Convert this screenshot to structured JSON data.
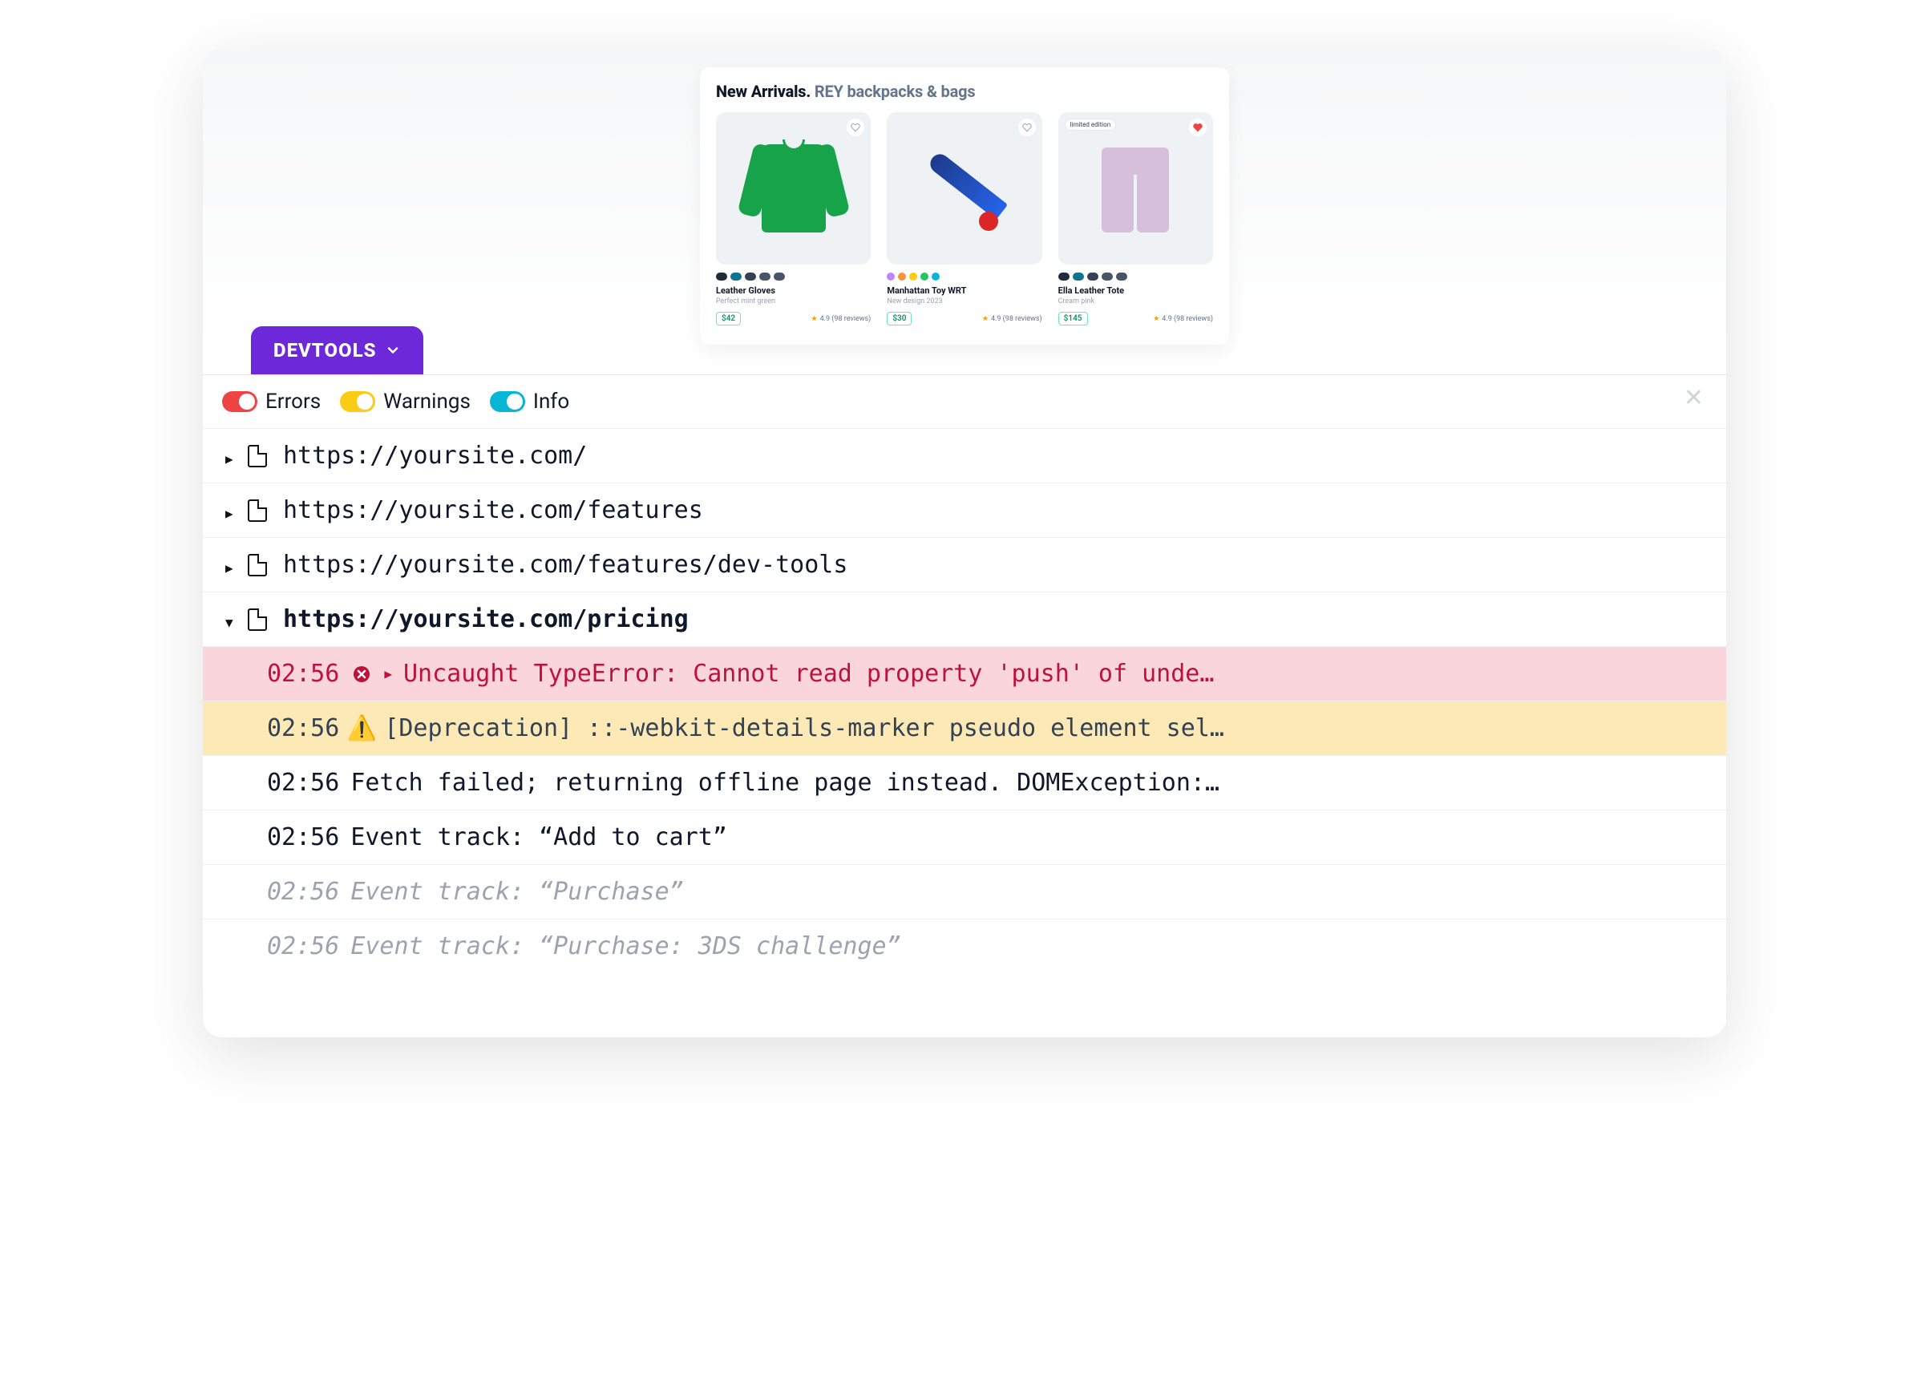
{
  "preview": {
    "title_bold": "New Arrivals.",
    "title_sub": "REY backpacks & bags",
    "products": [
      {
        "name": "Leather Gloves",
        "desc": "Perfect mint green",
        "price": "$42",
        "rating": "4.9 (98 reviews)",
        "badge": null,
        "favorite": false,
        "swatches": [
          "#1f2d3a",
          "#0e7490",
          "#334155",
          "#475569",
          "#475569"
        ],
        "swatch_style": "pill"
      },
      {
        "name": "Manhattan Toy WRT",
        "desc": "New design 2023",
        "price": "$30",
        "rating": "4.9 (98 reviews)",
        "badge": null,
        "favorite": false,
        "swatches": [
          "#c084fc",
          "#fb923c",
          "#facc15",
          "#22c55e",
          "#06b6d4"
        ],
        "swatch_style": "dot"
      },
      {
        "name": "Ella Leather Tote",
        "desc": "Cream pink",
        "price": "$145",
        "rating": "4.9 (98 reviews)",
        "badge": "limited edition",
        "favorite": true,
        "swatches": [
          "#1f2d3a",
          "#0e7490",
          "#334155",
          "#475569",
          "#475569"
        ],
        "swatch_style": "pill"
      }
    ]
  },
  "devtools_label": "DEVTOOLS",
  "filters": {
    "errors": "Errors",
    "warnings": "Warnings",
    "info": "Info"
  },
  "close_symbol": "✕",
  "pages": [
    {
      "url": "https://yoursite.com/",
      "open": false
    },
    {
      "url": "https://yoursite.com/features",
      "open": false
    },
    {
      "url": "https://yoursite.com/features/dev-tools",
      "open": false
    },
    {
      "url": "https://yoursite.com/pricing",
      "open": true
    }
  ],
  "logs": [
    {
      "ts": "02:56",
      "level": "err",
      "expandable": true,
      "msg": "Uncaught TypeError: Cannot read property 'push' of unde…"
    },
    {
      "ts": "02:56",
      "level": "warn",
      "expandable": false,
      "msg": "[Deprecation] ::-webkit-details-marker pseudo element sel…"
    },
    {
      "ts": "02:56",
      "level": "info",
      "expandable": false,
      "msg": "Fetch failed; returning offline page instead. DOMException:…"
    },
    {
      "ts": "02:56",
      "level": "info",
      "expandable": false,
      "msg": "Event track: “Add to cart”"
    },
    {
      "ts": "02:56",
      "level": "faded",
      "expandable": false,
      "msg": "Event track: “Purchase”"
    },
    {
      "ts": "02:56",
      "level": "faded",
      "expandable": false,
      "msg": "Event track: “Purchase: 3DS challenge”"
    }
  ],
  "icons": {
    "warn_emoji": "⚠️"
  }
}
